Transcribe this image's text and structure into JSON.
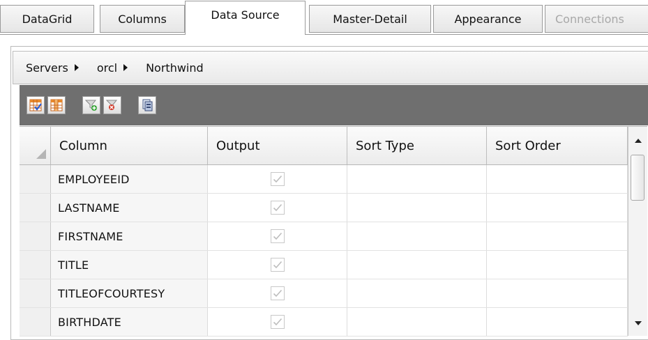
{
  "tabs": [
    {
      "label": "DataGrid",
      "state": "normal"
    },
    {
      "label": "Columns",
      "state": "normal"
    },
    {
      "label": "Data Source",
      "state": "active"
    },
    {
      "label": "Master-Detail",
      "state": "normal"
    },
    {
      "label": "Appearance",
      "state": "normal"
    },
    {
      "label": "Connections",
      "state": "disabled"
    }
  ],
  "breadcrumb": [
    "Servers",
    "orcl",
    "Northwind"
  ],
  "toolbar": {
    "buttons": [
      "select-all-columns-icon",
      "deselect-columns-icon",
      "add-filter-icon",
      "remove-filter-icon",
      "query-properties-icon"
    ]
  },
  "grid": {
    "columns": [
      "Column",
      "Output",
      "Sort Type",
      "Sort Order"
    ],
    "rows": [
      {
        "column": "EMPLOYEEID",
        "output": true,
        "sort_type": "",
        "sort_order": ""
      },
      {
        "column": "LASTNAME",
        "output": true,
        "sort_type": "",
        "sort_order": ""
      },
      {
        "column": "FIRSTNAME",
        "output": true,
        "sort_type": "",
        "sort_order": ""
      },
      {
        "column": "TITLE",
        "output": true,
        "sort_type": "",
        "sort_order": ""
      },
      {
        "column": "TITLEOFCOURTESY",
        "output": true,
        "sort_type": "",
        "sort_order": ""
      },
      {
        "column": "BIRTHDATE",
        "output": true,
        "sort_type": "",
        "sort_order": ""
      }
    ]
  },
  "colors": {
    "toolbar_bg": "#6f6f6f",
    "tab_border": "#9a9a9a",
    "disabled_text": "#a8a8a8"
  }
}
